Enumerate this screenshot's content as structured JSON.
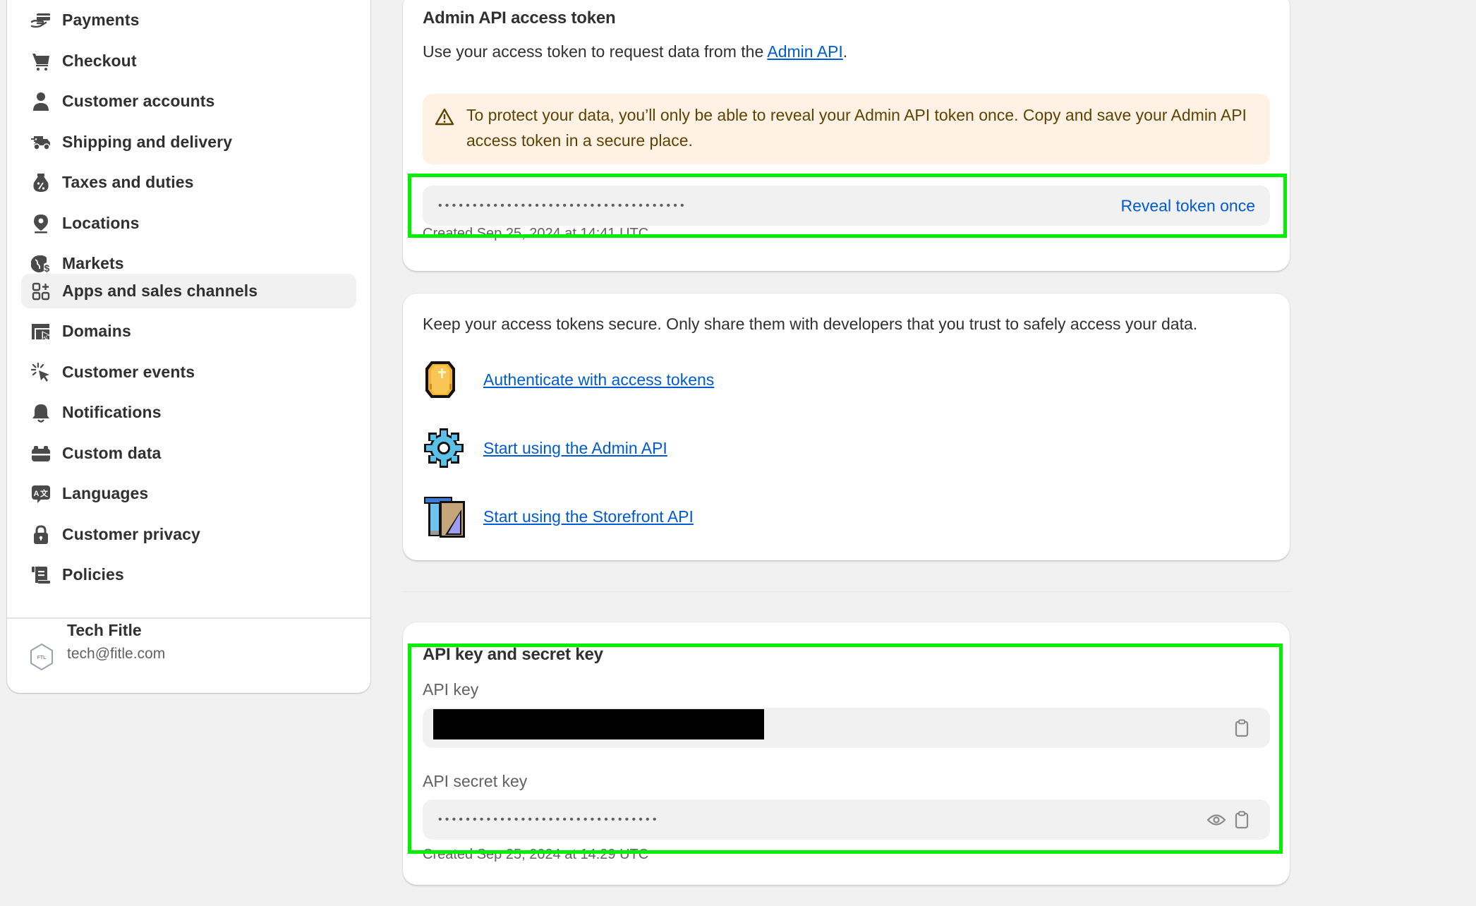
{
  "sidebar": {
    "items": [
      {
        "label": "Payments",
        "icon": "payments-icon",
        "active": false
      },
      {
        "label": "Checkout",
        "icon": "cart-icon",
        "active": false
      },
      {
        "label": "Customer accounts",
        "icon": "person-icon",
        "active": false
      },
      {
        "label": "Shipping and delivery",
        "icon": "truck-icon",
        "active": false
      },
      {
        "label": "Taxes and duties",
        "icon": "tax-bag-icon",
        "active": false
      },
      {
        "label": "Locations",
        "icon": "location-pin-icon",
        "active": false
      },
      {
        "label": "Markets",
        "icon": "globe-dollar-icon",
        "active": false
      },
      {
        "label": "Apps and sales channels",
        "icon": "apps-icon",
        "active": true
      },
      {
        "label": "Domains",
        "icon": "domains-icon",
        "active": false
      },
      {
        "label": "Customer events",
        "icon": "cursor-click-icon",
        "active": false
      },
      {
        "label": "Notifications",
        "icon": "bell-icon",
        "active": false
      },
      {
        "label": "Custom data",
        "icon": "custom-data-icon",
        "active": false
      },
      {
        "label": "Languages",
        "icon": "translate-icon",
        "active": false
      },
      {
        "label": "Customer privacy",
        "icon": "lock-icon",
        "active": false
      },
      {
        "label": "Policies",
        "icon": "policies-icon",
        "active": false
      }
    ],
    "store": {
      "name": "Tech Fitle",
      "email": "tech@fitle.com",
      "avatar_text": "FTL"
    }
  },
  "access_token_card": {
    "title": "Admin API access token",
    "description_prefix": "Use your access token to request data from the ",
    "description_link": "Admin API",
    "description_suffix": ".",
    "warning": "To protect your data, you’ll only be able to reveal your Admin API token once. Copy and save your Admin API access token in a secure place.",
    "token_masked": "••••••••••••••••••••••••••••••••••••",
    "reveal_label": "Reveal token once",
    "created": "Created Sep 25, 2024 at 14:41 UTC"
  },
  "resources_card": {
    "intro": "Keep your access tokens secure. Only share them with developers that you trust to safely access your data.",
    "links": [
      {
        "label": "Authenticate with access tokens",
        "icon": "coin-icon"
      },
      {
        "label": "Start using the Admin API",
        "icon": "gear-icon"
      },
      {
        "label": "Start using the Storefront API",
        "icon": "storefront-tools-icon"
      }
    ]
  },
  "keys_card": {
    "title": "API key and secret key",
    "api_key_label": "API key",
    "api_key_value": "[redacted]",
    "api_secret_label": "API secret key",
    "api_secret_masked": "••••••••••••••••••••••••••••••••",
    "created": "Created Sep 25, 2024 at 14:29 UTC"
  },
  "colors": {
    "accent_link": "#005bd3",
    "warning_bg": "#fff1e3",
    "warning_text": "#5e4200",
    "highlight": "#00f000"
  }
}
